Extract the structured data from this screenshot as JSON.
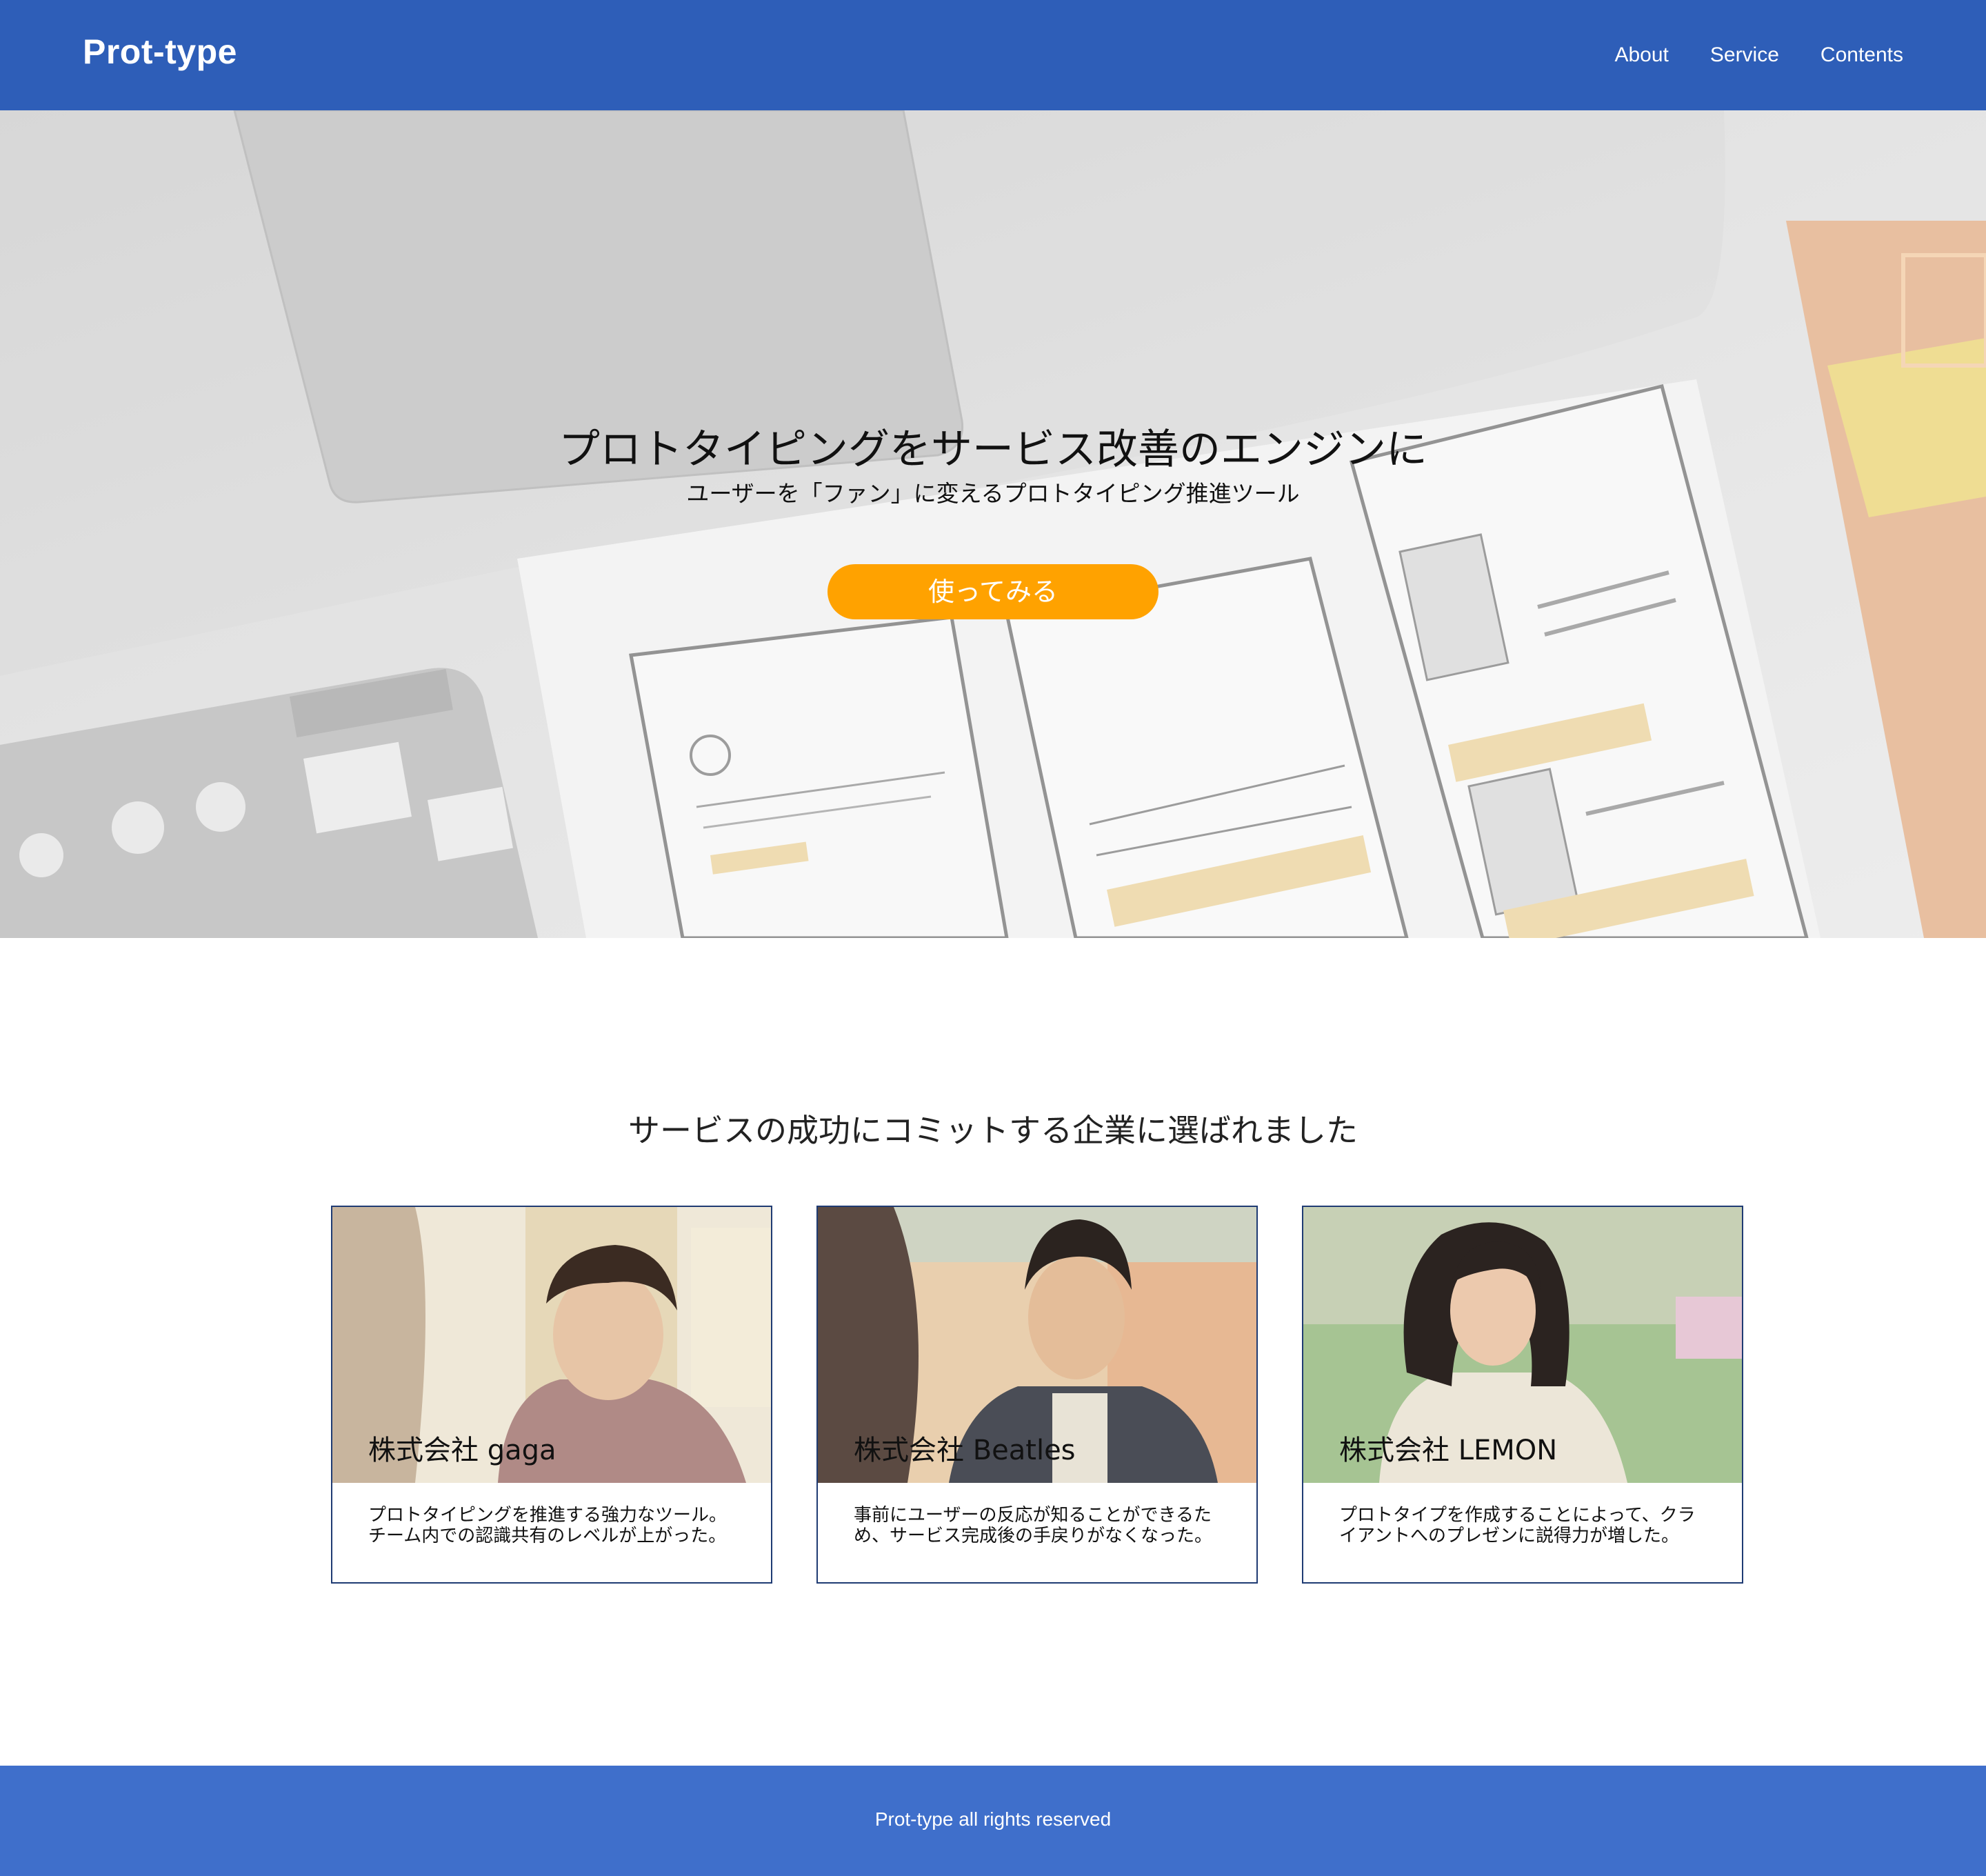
{
  "header": {
    "brand": "Prot-type",
    "nav": [
      "About",
      "Service",
      "Contents"
    ]
  },
  "hero": {
    "title": "プロトタイピングをサービス改善のエンジンに",
    "subtitle": "ユーザーを「ファン」に変えるプロトタイピング推進ツール",
    "cta_label": "使ってみる"
  },
  "clients": {
    "title": "サービスの成功にコミットする企業に選ばれました",
    "cards": [
      {
        "company": "株式会社 gaga",
        "description": "プロトタイピングを推進する強力なツール。チーム内での認識共有のレベルが上がった。"
      },
      {
        "company": "株式会社 Beatles",
        "description": "事前にユーザーの反応が知ることができるため、サービス完成後の手戻りがなくなった。"
      },
      {
        "company": "株式会社 LEMON",
        "description": "プロトタイプを作成することによって、クライアントへのプレゼンに説得力が増した。"
      }
    ]
  },
  "footer": {
    "text": "Prot-type all rights reserved"
  },
  "colors": {
    "header_bg": "#2e5eb8",
    "footer_bg": "#3f6fcb",
    "cta_bg": "#ffa200",
    "card_border": "#1f3b73"
  }
}
